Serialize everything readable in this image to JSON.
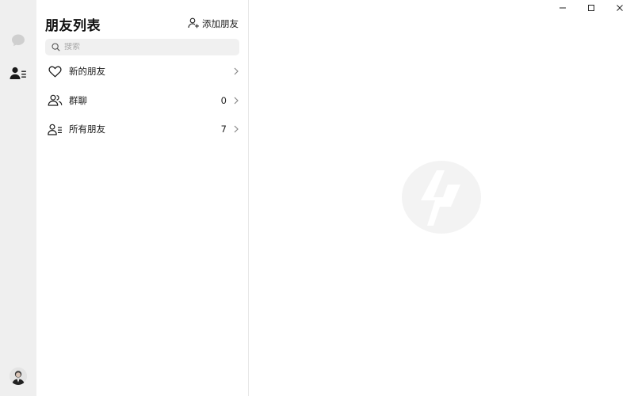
{
  "panel": {
    "title": "朋友列表",
    "add_friend_label": "添加朋友"
  },
  "search": {
    "placeholder": "搜索",
    "value": ""
  },
  "list": {
    "items": [
      {
        "label": "新的朋友",
        "count": "",
        "icon": "heart-icon"
      },
      {
        "label": "群聊",
        "count": "0",
        "icon": "group-icon"
      },
      {
        "label": "所有朋友",
        "count": "7",
        "icon": "contacts-list-icon"
      }
    ]
  },
  "rail": {
    "items": [
      {
        "icon": "chat-bubble-icon",
        "active": false
      },
      {
        "icon": "contacts-icon",
        "active": true
      }
    ]
  },
  "window_controls": [
    "minimize-icon",
    "maximize-icon",
    "close-icon"
  ],
  "colors": {
    "rail_bg": "#efefef",
    "search_bg": "#f0f0f0",
    "logo": "#f3f3f3",
    "text": "#1a1a1a"
  }
}
